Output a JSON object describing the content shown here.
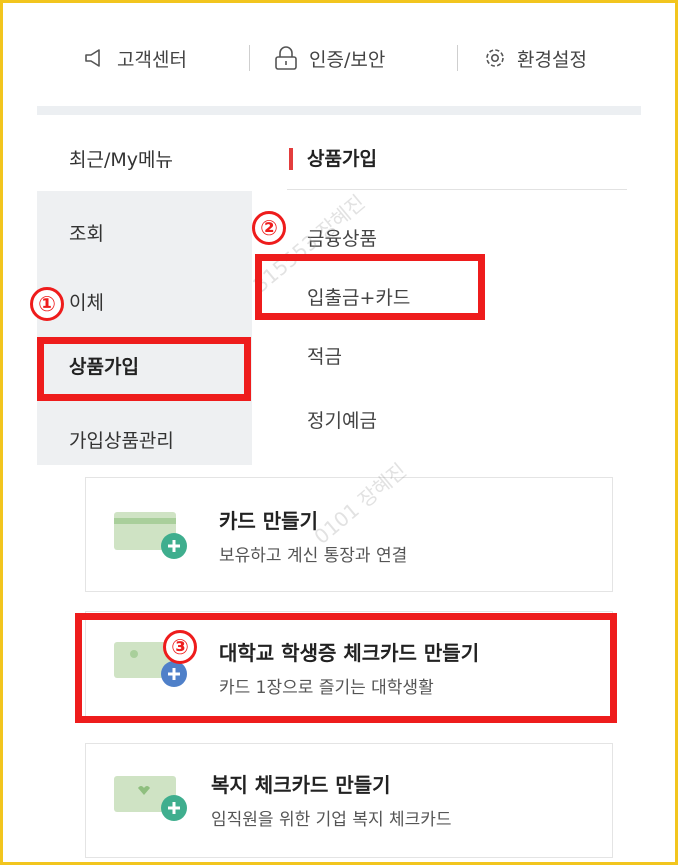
{
  "toolbar": {
    "items": [
      {
        "label": "고객센터",
        "icon": "speaker-icon"
      },
      {
        "label": "인증/보안",
        "icon": "lock-icon"
      },
      {
        "label": "환경설정",
        "icon": "gear-icon"
      }
    ]
  },
  "left_menu": {
    "items": [
      "최근/My메뉴",
      "조회",
      "이체",
      "상품가입",
      "가입상품관리"
    ],
    "selected": "상품가입"
  },
  "sub_menu": {
    "title": "상품가입",
    "items": [
      "금융상품",
      "입출금+카드",
      "적금",
      "정기예금"
    ]
  },
  "cards": [
    {
      "title": "카드 만들기",
      "desc": "보유하고 계신 통장과 연결"
    },
    {
      "title": "대학교 학생증 체크카드 만들기",
      "desc": "카드 1장으로 즐기는 대학생활"
    },
    {
      "title": "복지 체크카드 만들기",
      "desc": "임직원을 위한 기업 복지 체크카드"
    }
  ],
  "annotations": {
    "step1": "①",
    "step2": "②",
    "step3": "③"
  },
  "watermark": {
    "text": "315553 장혜진",
    "text2": "0101 장혜진"
  },
  "colors": {
    "frame_border": "#f2c51e",
    "highlight": "#ee1c1c",
    "accent_bar": "#e33d3d",
    "menu_bg": "#eef0f2",
    "icon_blue": "#4f80c9",
    "icon_green": "#3fae8e"
  }
}
